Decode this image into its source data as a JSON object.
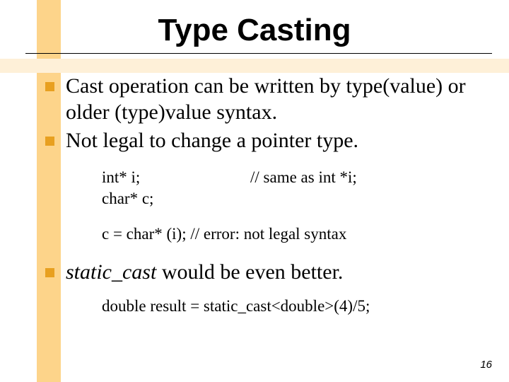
{
  "title": "Type Casting",
  "bullets": {
    "b1": "Cast operation can be written by type(value) or older  (type)value  syntax.",
    "b2": "Not legal to change a pointer type.",
    "b3_pre": "static_cast",
    "b3_post": " would be even better."
  },
  "code": {
    "l1a": "int*  i;",
    "l1b": "// same as int   *i;",
    "l2": "char*  c;",
    "l3": "c = char* (i); // error: not legal syntax",
    "l4": "double result = static_cast<double>(4)/5;"
  },
  "page_number": "16"
}
